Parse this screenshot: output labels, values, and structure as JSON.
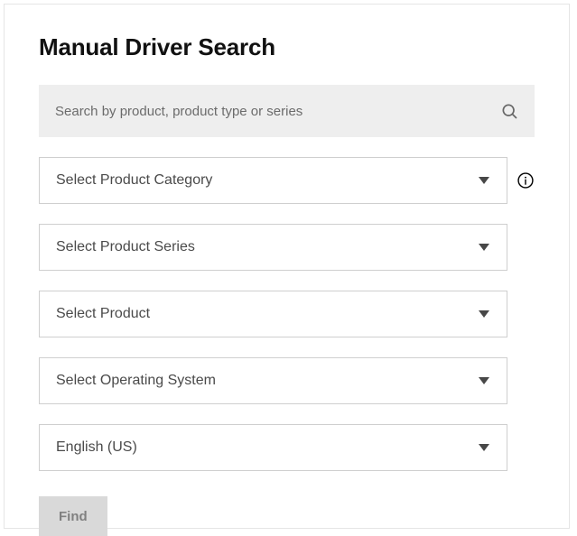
{
  "title": "Manual Driver Search",
  "search": {
    "placeholder": "Search by product, product type or series"
  },
  "selects": {
    "product_category": "Select Product Category",
    "product_series": "Select Product Series",
    "product": "Select Product",
    "operating_system": "Select Operating System",
    "language": "English (US)"
  },
  "buttons": {
    "find": "Find"
  }
}
